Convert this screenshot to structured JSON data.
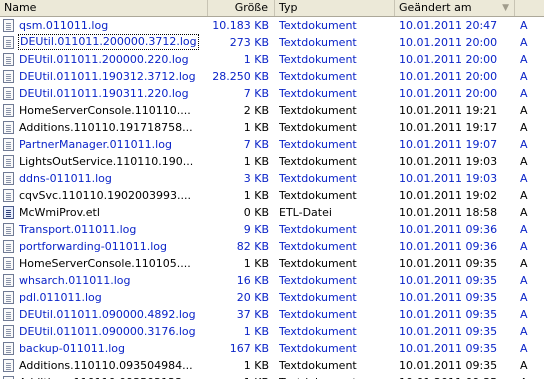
{
  "header": {
    "name": "Name",
    "size": "Größe",
    "type": "Typ",
    "date": "Geändert am",
    "sort_indicator": "▼"
  },
  "rows": [
    {
      "name": "qsm.011011.log",
      "size": "10.183 KB",
      "type": "Textdokument",
      "date": "10.01.2011 20:47",
      "extra": "A",
      "icon": "text-file-icon",
      "blue": true,
      "selected": false
    },
    {
      "name": "DEUtil.011011.200000.3712.log",
      "size": "273 KB",
      "type": "Textdokument",
      "date": "10.01.2011 20:00",
      "extra": "A",
      "icon": "text-file-icon",
      "blue": true,
      "selected": true
    },
    {
      "name": "DEUtil.011011.200000.220.log",
      "size": "1 KB",
      "type": "Textdokument",
      "date": "10.01.2011 20:00",
      "extra": "A",
      "icon": "text-file-icon",
      "blue": true,
      "selected": false
    },
    {
      "name": "DEUtil.011011.190312.3712.log",
      "size": "28.250 KB",
      "type": "Textdokument",
      "date": "10.01.2011 20:00",
      "extra": "A",
      "icon": "text-file-icon",
      "blue": true,
      "selected": false
    },
    {
      "name": "DEUtil.011011.190311.220.log",
      "size": "7 KB",
      "type": "Textdokument",
      "date": "10.01.2011 20:00",
      "extra": "A",
      "icon": "text-file-icon",
      "blue": true,
      "selected": false
    },
    {
      "name": "HomeServerConsole.110110....",
      "size": "2 KB",
      "type": "Textdokument",
      "date": "10.01.2011 19:21",
      "extra": "A",
      "icon": "text-file-icon",
      "blue": false,
      "selected": false
    },
    {
      "name": "Additions.110110.191718758...",
      "size": "1 KB",
      "type": "Textdokument",
      "date": "10.01.2011 19:17",
      "extra": "A",
      "icon": "text-file-icon",
      "blue": false,
      "selected": false
    },
    {
      "name": "PartnerManager.011011.log",
      "size": "7 KB",
      "type": "Textdokument",
      "date": "10.01.2011 19:07",
      "extra": "A",
      "icon": "text-file-icon",
      "blue": true,
      "selected": false
    },
    {
      "name": "LightsOutService.110110.190...",
      "size": "1 KB",
      "type": "Textdokument",
      "date": "10.01.2011 19:03",
      "extra": "A",
      "icon": "text-file-icon",
      "blue": false,
      "selected": false
    },
    {
      "name": "ddns-011011.log",
      "size": "3 KB",
      "type": "Textdokument",
      "date": "10.01.2011 19:03",
      "extra": "A",
      "icon": "text-file-icon",
      "blue": true,
      "selected": false
    },
    {
      "name": "cqvSvc.110110.1902003993....",
      "size": "1 KB",
      "type": "Textdokument",
      "date": "10.01.2011 19:02",
      "extra": "A",
      "icon": "text-file-icon",
      "blue": false,
      "selected": false
    },
    {
      "name": "McWmiProv.etl",
      "size": "0 KB",
      "type": "ETL-Datei",
      "date": "10.01.2011 18:58",
      "extra": "A",
      "icon": "etl-file-icon",
      "blue": false,
      "selected": false
    },
    {
      "name": "Transport.011011.log",
      "size": "9 KB",
      "type": "Textdokument",
      "date": "10.01.2011 09:36",
      "extra": "A",
      "icon": "text-file-icon",
      "blue": true,
      "selected": false
    },
    {
      "name": "portforwarding-011011.log",
      "size": "82 KB",
      "type": "Textdokument",
      "date": "10.01.2011 09:36",
      "extra": "A",
      "icon": "text-file-icon",
      "blue": true,
      "selected": false
    },
    {
      "name": "HomeServerConsole.110105....",
      "size": "1 KB",
      "type": "Textdokument",
      "date": "10.01.2011 09:35",
      "extra": "A",
      "icon": "text-file-icon",
      "blue": false,
      "selected": false
    },
    {
      "name": "whsarch.011011.log",
      "size": "16 KB",
      "type": "Textdokument",
      "date": "10.01.2011 09:35",
      "extra": "A",
      "icon": "text-file-icon",
      "blue": true,
      "selected": false
    },
    {
      "name": "pdl.011011.log",
      "size": "20 KB",
      "type": "Textdokument",
      "date": "10.01.2011 09:35",
      "extra": "A",
      "icon": "text-file-icon",
      "blue": true,
      "selected": false
    },
    {
      "name": "DEUtil.011011.090000.4892.log",
      "size": "37 KB",
      "type": "Textdokument",
      "date": "10.01.2011 09:35",
      "extra": "A",
      "icon": "text-file-icon",
      "blue": true,
      "selected": false
    },
    {
      "name": "DEUtil.011011.090000.3176.log",
      "size": "1 KB",
      "type": "Textdokument",
      "date": "10.01.2011 09:35",
      "extra": "A",
      "icon": "text-file-icon",
      "blue": true,
      "selected": false
    },
    {
      "name": "backup-011011.log",
      "size": "167 KB",
      "type": "Textdokument",
      "date": "10.01.2011 09:35",
      "extra": "A",
      "icon": "text-file-icon",
      "blue": true,
      "selected": false
    },
    {
      "name": "Additions.110110.093504984...",
      "size": "1 KB",
      "type": "Textdokument",
      "date": "10.01.2011 09:35",
      "extra": "A",
      "icon": "text-file-icon",
      "blue": false,
      "selected": false
    },
    {
      "name": "Additions.110110.093502123...",
      "size": "1 KB",
      "type": "Textdokument",
      "date": "10.01.2011 09:35",
      "extra": "A",
      "icon": "text-file-icon",
      "blue": false,
      "selected": false
    }
  ]
}
